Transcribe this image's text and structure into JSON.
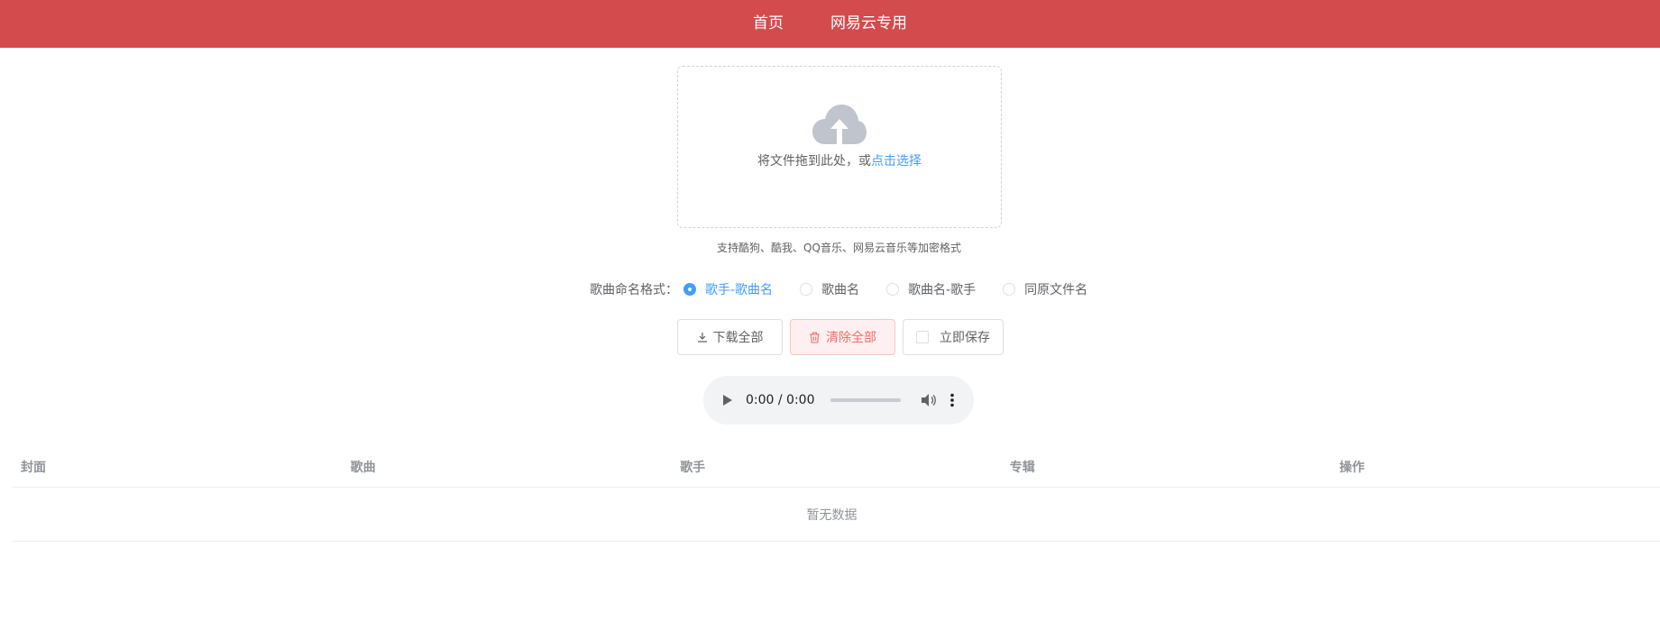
{
  "nav": {
    "items": [
      "首页",
      "网易云专用"
    ]
  },
  "upload": {
    "text": "将文件拖到此处，或",
    "link": "点击选择",
    "tip": "支持酷狗、酷我、QQ音乐、网易云音乐等加密格式"
  },
  "naming": {
    "label": "歌曲命名格式：",
    "options": [
      "歌手-歌曲名",
      "歌曲名",
      "歌曲名-歌手",
      "同原文件名"
    ],
    "selected_index": 0
  },
  "actions": {
    "download_all": "下载全部",
    "clear_all": "清除全部",
    "save_now": "立即保存"
  },
  "audio": {
    "time": "0:00 / 0:00"
  },
  "table": {
    "columns": [
      "封面",
      "歌曲",
      "歌手",
      "专辑",
      "操作"
    ],
    "empty_text": "暂无数据"
  },
  "colors": {
    "brand_red": "#d44b4d",
    "link_blue": "#409eff",
    "danger": "#f56c6c"
  }
}
